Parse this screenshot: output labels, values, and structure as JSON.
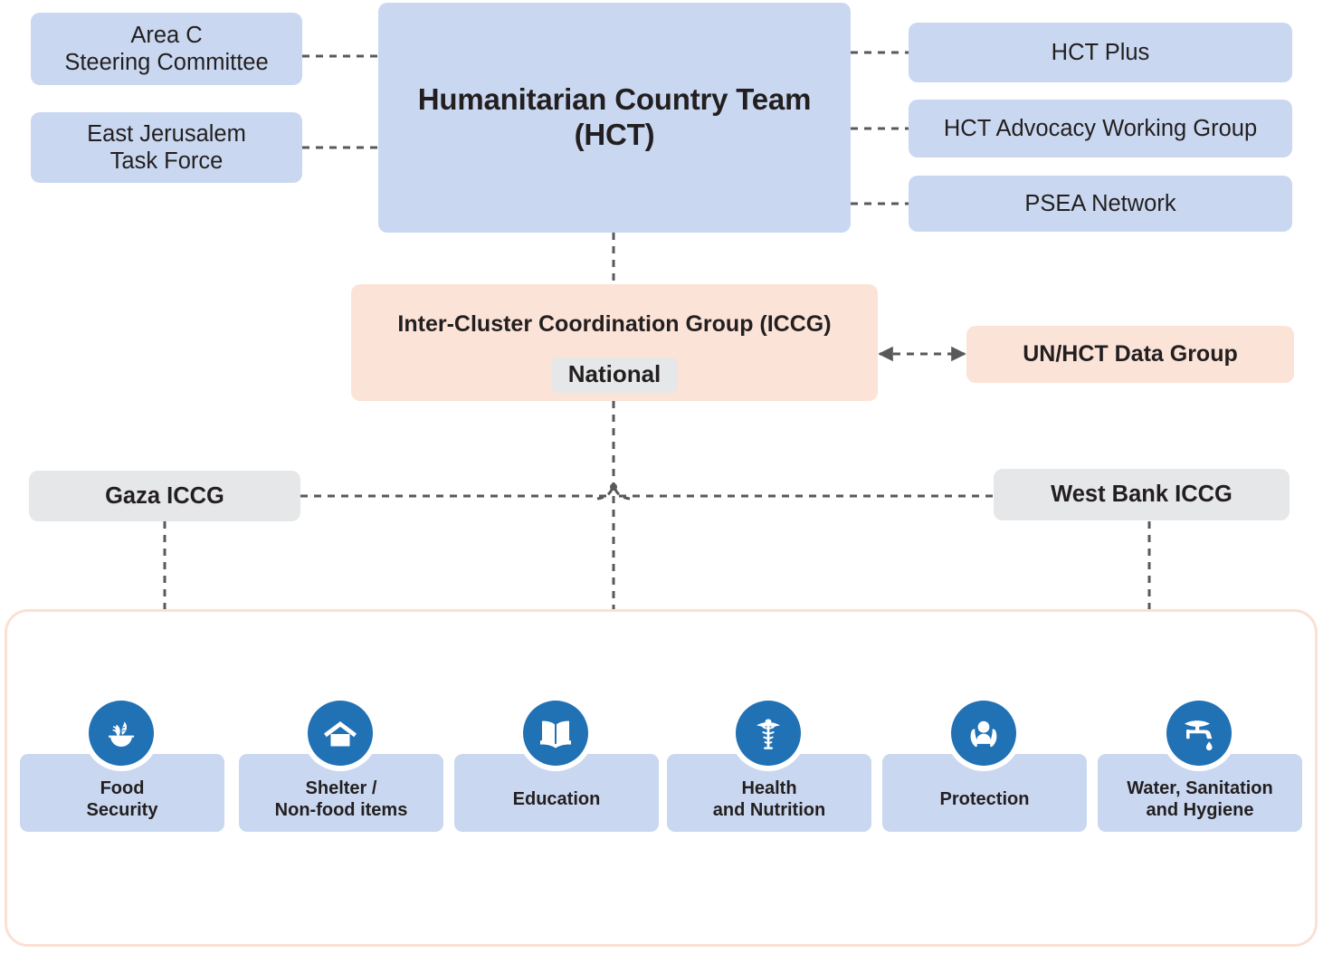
{
  "diagram": {
    "title_node": "Humanitarian Country Team\n(HCT)",
    "left_nodes": [
      {
        "label": "Area C\nSteering Committee"
      },
      {
        "label": "East Jerusalem\nTask Force"
      }
    ],
    "right_nodes": [
      {
        "label": "HCT Plus"
      },
      {
        "label": "HCT Advocacy Working Group"
      },
      {
        "label": "PSEA Network"
      }
    ],
    "iccg": {
      "title": "Inter-Cluster Coordination Group (ICCG)",
      "scope_badge": "National"
    },
    "data_group": {
      "label": "UN/HCT Data Group"
    },
    "regional_iccg": [
      {
        "label": "Gaza ICCG"
      },
      {
        "label": "West Bank ICCG"
      }
    ],
    "clusters": [
      {
        "label": "Food\nSecurity",
        "icon": "wheat-bowl-icon"
      },
      {
        "label": "Shelter /\nNon-food items",
        "icon": "house-icon"
      },
      {
        "label": "Education",
        "icon": "open-book-icon"
      },
      {
        "label": "Health\nand Nutrition",
        "icon": "caduceus-icon"
      },
      {
        "label": "Protection",
        "icon": "hands-person-icon"
      },
      {
        "label": "Water, Sanitation\nand Hygiene",
        "icon": "faucet-drop-icon"
      }
    ],
    "colors": {
      "blue_fill": "#c9d8f0",
      "peach_fill": "#fbe3d8",
      "grey_fill": "#e6e7e8",
      "icon_blue": "#2171b5",
      "container_border": "#fbe0d4",
      "connector": "#58595b",
      "text": "#231f20"
    }
  }
}
